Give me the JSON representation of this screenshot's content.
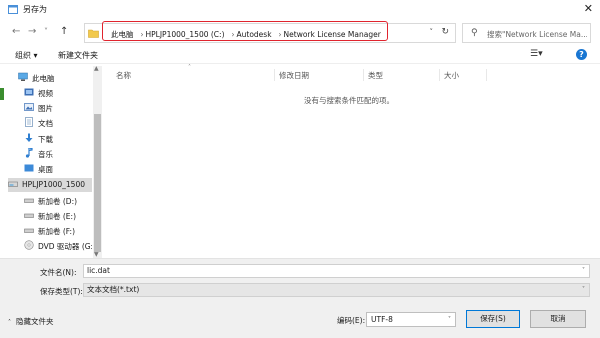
{
  "window": {
    "title": "另存为",
    "close_glyph": "✕"
  },
  "nav": {
    "back": "←",
    "forward": "→",
    "dropdown": "˅",
    "up": "↑",
    "breadcrumbs": [
      "此电脑",
      "HPLJP1000_1500 (C:)",
      "Autodesk",
      "Network License Manager"
    ],
    "separator": "›",
    "address_dropdown": "˅",
    "refresh": "↻",
    "search_placeholder": "搜索\"Network License Ma..."
  },
  "toolbar": {
    "organize_label": "组织 ▾",
    "new_folder_label": "新建文件夹",
    "view_glyph": "☰▾",
    "help_glyph": "?"
  },
  "sidebar": {
    "items": [
      {
        "label": "此电脑",
        "icon": "pc-icon"
      },
      {
        "label": "视频",
        "icon": "video-icon"
      },
      {
        "label": "图片",
        "icon": "pictures-icon"
      },
      {
        "label": "文档",
        "icon": "documents-icon"
      },
      {
        "label": "下载",
        "icon": "download-icon"
      },
      {
        "label": "音乐",
        "icon": "music-icon"
      },
      {
        "label": "桌面",
        "icon": "desktop-icon"
      },
      {
        "label": "HPLJP1000_1500",
        "icon": "drive-icon",
        "selected": true
      },
      {
        "label": "新加卷 (D:)",
        "icon": "drive-icon"
      },
      {
        "label": "新加卷 (E:)",
        "icon": "drive-icon"
      },
      {
        "label": "新加卷 (F:)",
        "icon": "drive-icon"
      },
      {
        "label": "DVD 驱动器 (G:",
        "icon": "dvd-icon"
      }
    ]
  },
  "content": {
    "columns": [
      "名称",
      "修改日期",
      "类型",
      "大小"
    ],
    "empty_message": "没有与搜索条件匹配的项。"
  },
  "bottom": {
    "filename_label": "文件名(N):",
    "filename_value": "lic.dat",
    "filetype_label": "保存类型(T):",
    "filetype_value": "文本文档(*.txt)",
    "hide_folders_label": "隐藏文件夹",
    "encoding_label": "编码(E):",
    "encoding_value": "UTF-8",
    "save_label": "保存(S)",
    "cancel_label": "取消"
  },
  "colors": {
    "highlight": "#e0242e",
    "accent": "#0078d7",
    "help": "#1976d2"
  }
}
